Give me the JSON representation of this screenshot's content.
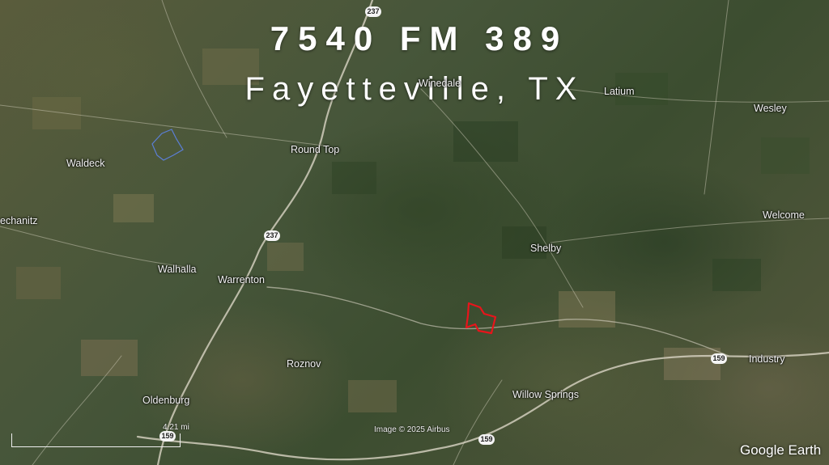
{
  "header": {
    "address": "7540 FM 389",
    "city": "Fayetteville, TX"
  },
  "places": {
    "latium": "Latium",
    "wesley": "Wesley",
    "waldeck": "Waldeck",
    "round_top": "Round Top",
    "welcome": "Welcome",
    "mechanitz": "echanitz",
    "shelby": "Shelby",
    "walhalla": "Walhalla",
    "warrenton": "Warrenton",
    "industry": "Industry",
    "roznov": "Roznov",
    "willow_springs": "Willow Springs",
    "oldenburg": "Oldenburg",
    "winedale": "Winedale"
  },
  "routes": {
    "r237_top": "237",
    "r237_mid": "237",
    "r159_right": "159",
    "r159_bottom": "159",
    "r159_left": "159"
  },
  "footer": {
    "scale": "4.21 mi",
    "credit": "Image © 2025 Airbus",
    "brand": "Google Earth"
  },
  "colors": {
    "parcel_outline": "#e8141b",
    "road": "#d9d4c4",
    "water_outline": "#5b7fd6"
  }
}
